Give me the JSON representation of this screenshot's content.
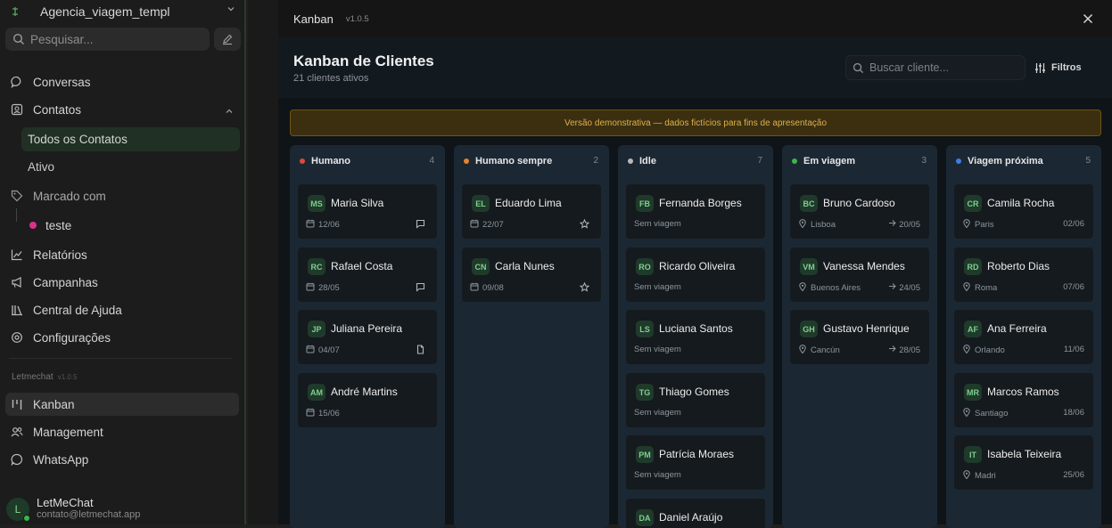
{
  "sidebar": {
    "workspace": "Agencia_viagem_templ",
    "search_placeholder": "Pesquisar...",
    "nav": {
      "conversas": "Conversas",
      "contatos": "Contatos",
      "todos": "Todos os Contatos",
      "ativo": "Ativo",
      "marcado": "Marcado com",
      "teste": "teste",
      "relatorios": "Relatórios",
      "campanhas": "Campanhas",
      "ajuda": "Central de Ajuda",
      "config": "Configurações"
    },
    "section_label": "Letmechat",
    "section_version": "v1.0.5",
    "apps": {
      "kanban": "Kanban",
      "management": "Management",
      "whatsapp": "WhatsApp"
    },
    "user": {
      "initial": "L",
      "name": "LetMeChat",
      "email": "contato@letmechat.app"
    }
  },
  "modal": {
    "title": "Kanban",
    "version": "v1.0.5",
    "heading": "Kanban de Clientes",
    "subheading": "21 clientes ativos",
    "search_placeholder": "Buscar cliente...",
    "filters_label": "Filtros",
    "banner": "Versão demonstrativa — dados fictícios para fins de apresentação"
  },
  "colors": {
    "humano": "#e0473b",
    "humano_sempre": "#e8822c",
    "idle": "#b8b8b8",
    "em_viagem": "#3bb54a",
    "viagem_proxima": "#3f7ee0"
  },
  "columns": [
    {
      "name": "Humano",
      "count": "4",
      "cards": [
        {
          "initials": "MS",
          "name": "Maria Silva",
          "meta": "12/06",
          "icon": "chat-icon"
        },
        {
          "initials": "RC",
          "name": "Rafael Costa",
          "meta": "28/05",
          "icon": "chat-icon"
        },
        {
          "initials": "JP",
          "name": "Juliana Pereira",
          "meta": "04/07",
          "icon": "document-icon"
        },
        {
          "initials": "AM",
          "name": "André Martins",
          "meta": "15/06",
          "icon": ""
        }
      ]
    },
    {
      "name": "Humano sempre",
      "count": "2",
      "cards": [
        {
          "initials": "EL",
          "name": "Eduardo Lima",
          "meta": "22/07",
          "icon": "star-icon"
        },
        {
          "initials": "CN",
          "name": "Carla Nunes",
          "meta": "09/08",
          "icon": "star-icon"
        }
      ]
    },
    {
      "name": "Idle",
      "count": "7",
      "cards": [
        {
          "initials": "FB",
          "name": "Fernanda Borges",
          "meta": "Sem viagem"
        },
        {
          "initials": "RO",
          "name": "Ricardo Oliveira",
          "meta": "Sem viagem"
        },
        {
          "initials": "LS",
          "name": "Luciana Santos",
          "meta": "Sem viagem"
        },
        {
          "initials": "TG",
          "name": "Thiago Gomes",
          "meta": "Sem viagem"
        },
        {
          "initials": "PM",
          "name": "Patrícia Moraes",
          "meta": "Sem viagem"
        },
        {
          "initials": "DA",
          "name": "Daniel Araújo",
          "meta": ""
        }
      ]
    },
    {
      "name": "Em viagem",
      "count": "3",
      "cards": [
        {
          "initials": "BC",
          "name": "Bruno Cardoso",
          "meta": "Lisboa",
          "right": "20/05"
        },
        {
          "initials": "VM",
          "name": "Vanessa Mendes",
          "meta": "Buenos Aires",
          "right": "24/05"
        },
        {
          "initials": "GH",
          "name": "Gustavo Henrique",
          "meta": "Cancún",
          "right": "28/05"
        }
      ]
    },
    {
      "name": "Viagem próxima",
      "count": "5",
      "cards": [
        {
          "initials": "CR",
          "name": "Camila Rocha",
          "meta": "Paris",
          "right": "02/06"
        },
        {
          "initials": "RD",
          "name": "Roberto Dias",
          "meta": "Roma",
          "right": "07/06"
        },
        {
          "initials": "AF",
          "name": "Ana Ferreira",
          "meta": "Orlando",
          "right": "11/06"
        },
        {
          "initials": "MR",
          "name": "Marcos Ramos",
          "meta": "Santiago",
          "right": "18/06"
        },
        {
          "initials": "IT",
          "name": "Isabela Teixeira",
          "meta": "Madri",
          "right": "25/06"
        }
      ]
    }
  ]
}
